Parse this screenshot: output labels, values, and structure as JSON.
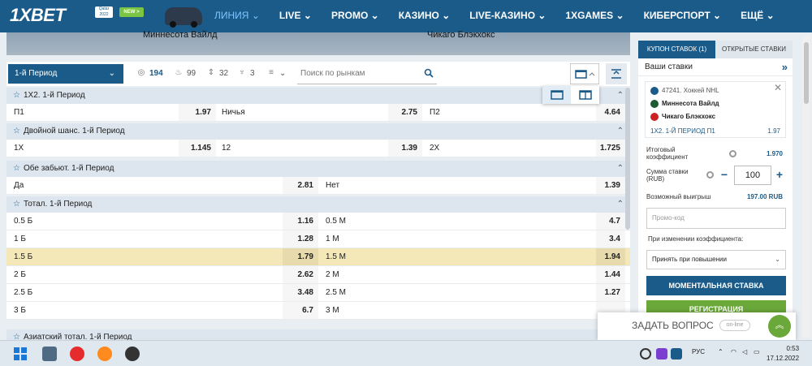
{
  "header": {
    "logo": "1XBET",
    "qatar_badge": "Qatar 2022",
    "new_badge": "NEW >",
    "nav": [
      {
        "label": "ЛИНИЯ",
        "active": true,
        "dropdown": true
      },
      {
        "label": "LIVE",
        "dropdown": true
      },
      {
        "label": "PROMO",
        "dropdown": true
      },
      {
        "label": "КАЗИНО",
        "dropdown": true
      },
      {
        "label": "LIVE-КАЗИНО",
        "dropdown": true
      },
      {
        "label": "1XGAMES",
        "dropdown": true
      },
      {
        "label": "КИБЕРСПОРТ",
        "dropdown": true
      },
      {
        "label": "ЕЩЁ",
        "dropdown": true
      }
    ]
  },
  "banner": {
    "team1": "Миннесота Вайлд",
    "team2": "Чикаго Блэкхокс"
  },
  "filter": {
    "period": "1-й Период",
    "count_all": "194",
    "count_hot": "99",
    "count_sort": "32",
    "count_cup": "3",
    "search_placeholder": "Поиск по рынкам"
  },
  "markets": [
    {
      "title": "1Х2. 1-й Период",
      "rows": [
        [
          {
            "l": "П1",
            "o": "1.97"
          },
          {
            "l": "Ничья",
            "o": "2.75"
          },
          {
            "l": "П2",
            "o": "4.64"
          }
        ]
      ]
    },
    {
      "title": "Двойной шанс. 1-й Период",
      "rows": [
        [
          {
            "l": "1Х",
            "o": "1.145"
          },
          {
            "l": "12",
            "o": "1.39"
          },
          {
            "l": "2Х",
            "o": "1.725"
          }
        ]
      ]
    },
    {
      "title": "Обе забьют. 1-й Период",
      "rows": [
        [
          {
            "l": "Да",
            "o": "2.81"
          },
          {
            "l": "Нет",
            "o": "1.39"
          }
        ]
      ]
    },
    {
      "title": "Тотал. 1-й Период",
      "rows": [
        [
          {
            "l": "0.5 Б",
            "o": "1.16"
          },
          {
            "l": "0.5 М",
            "o": "4.7"
          }
        ],
        [
          {
            "l": "1 Б",
            "o": "1.28"
          },
          {
            "l": "1 М",
            "o": "3.4"
          }
        ],
        [
          {
            "l": "1.5 Б",
            "o": "1.79"
          },
          {
            "l": "1.5 М",
            "o": "1.94"
          }
        ],
        [
          {
            "l": "2 Б",
            "o": "2.62"
          },
          {
            "l": "2 М",
            "o": "1.44"
          }
        ],
        [
          {
            "l": "2.5 Б",
            "o": "3.48"
          },
          {
            "l": "2.5 М",
            "o": "1.27"
          }
        ],
        [
          {
            "l": "3 Б",
            "o": "6.7"
          },
          {
            "l": "3 М",
            "o": ""
          }
        ]
      ]
    },
    {
      "title": "Азиатский тотал. 1-й Период",
      "rows": []
    }
  ],
  "coupon": {
    "tab_active": "КУПОН СТАВОК (1)",
    "tab_other": "ОТКРЫТЫЕ СТАВКИ",
    "your_bets": "Ваши ставки",
    "league": "47241. Хоккей NHL",
    "team1": "Миннесота Вайлд",
    "team2": "Чикаго Блэкхокс",
    "bet_desc": "1Х2. 1-Й ПЕРИОД П1",
    "bet_odd": "1.97",
    "total_label_1": "Итоговый",
    "total_label_2": "коэффициент",
    "total_val": "1.970",
    "stake_label_1": "Сумма ставки",
    "stake_label_2": "(RUB)",
    "stake_value": "100",
    "win_label": "Возможный выигрыш",
    "win_val": "197.00 RUB",
    "promo_placeholder": "Промо-код",
    "change_label": "При изменении коэффициента:",
    "accept_option": "Принять при повышении",
    "instant_btn": "МОМЕНТАЛЬНАЯ СТАВКА",
    "reg_btn": "РЕГИСТРАЦИЯ"
  },
  "chat": {
    "label": "ЗАДАТЬ ВОПРОС",
    "status": "on-line"
  },
  "taskbar": {
    "lang": "РУС",
    "time": "0:53",
    "date": "17.12.2022"
  }
}
